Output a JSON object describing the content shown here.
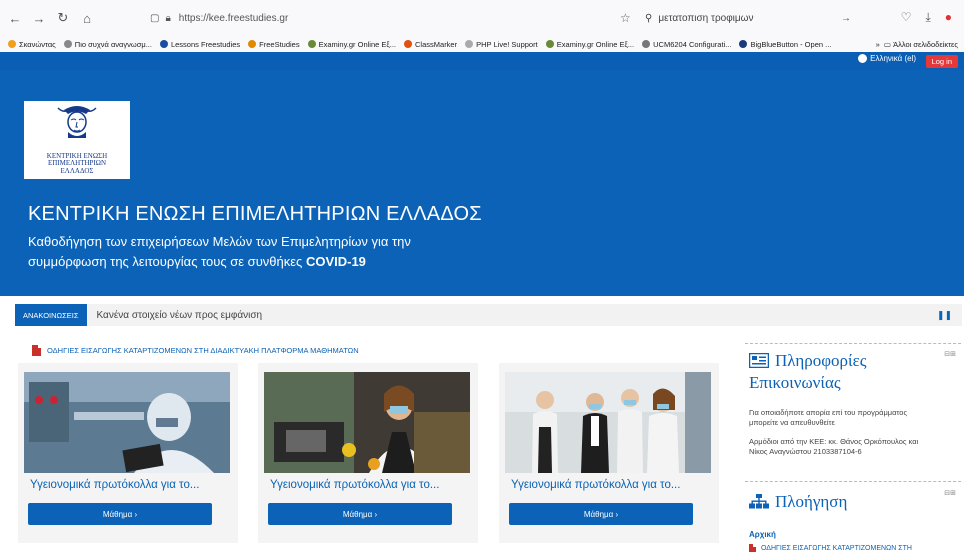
{
  "browser": {
    "url": "https://kee.freestudies.gr",
    "search": "μετατοπιση τροφιμων",
    "bookmarks": [
      "Σκανώντας",
      "Πιο συχνά αναγνωσμ...",
      "Lessons Freestudies",
      "FreeStudies",
      "Examiny.gr Online Εξ...",
      "ClassMarker",
      "PHP Live! Support",
      "Examiny.gr Online Εξ...",
      "UCM6204 Configurati...",
      "BigBlueButton - Open ..."
    ],
    "other_bookmarks": "Άλλοι σελιδοδείκτες"
  },
  "header": {
    "language": "Ελληνικά (el)",
    "login": "Log in"
  },
  "hero": {
    "logo_text": [
      "ΚΕΝΤΡΙΚΗ ΕΝΩΣΗ",
      "ΕΠΙΜΕΛΗΤΗΡΙΩΝ",
      "ΕΛΛΑΔΟΣ"
    ],
    "title": "ΚΕΝΤΡΙΚΗ ΕΝΩΣΗ ΕΠΙΜΕΛΗΤΗΡΙΩΝ ΕΛΛΑΔΟΣ",
    "subtitle_line1": "Καθοδήγηση των επιχειρήσεων Μελών των Επιμελητηρίων για την",
    "subtitle_line2": "συμμόρφωση της λειτουργίας τους σε συνθήκες",
    "subtitle_bold": "COVID-19"
  },
  "news": {
    "tag": "ΑΝΑΚΟΙΝΩΣΕΙΣ",
    "text": "Κανένα στοιχείο νέων προς εμφάνιση"
  },
  "main": {
    "guide_link": "ΟΔΗΓΙΕΣ ΕΙΣΑΓΩΓΗΣ ΚΑΤΑΡΤΙΖΟΜΕΝΩΝ ΣΤΗ ΔΙΑΔΙΚΤΥΑΚΗ ΠΛΑΤΦΟΡΜΑ ΜΑΘΗΜΑΤΩΝ",
    "courses": [
      {
        "title": "Υγειονομικά πρωτόκολλα για το...",
        "button": "Μάθημα ›"
      },
      {
        "title": "Υγειονομικά πρωτόκολλα για το...",
        "button": "Μάθημα ›"
      },
      {
        "title": "Υγειονομικά πρωτόκολλα για το...",
        "button": "Μάθημα ›"
      }
    ]
  },
  "sidebar": {
    "contact": {
      "title_line1": "Πληροφορίες",
      "title_line2": "Επικοινωνίας",
      "text1_line1": "Για οποιαδήποτε απορία επί του προγράμματος",
      "text1_line2": "μπορείτε να απευθυνθείτε",
      "text2_line1": "Αρμόδιοι από την ΚΕΕ: κκ. Θάνος Ορκόπουλος και",
      "text2_line2": "Νίκος Αναγνώστου 2103387104-6"
    },
    "navigation": {
      "title": "Πλοήγηση",
      "home": "Αρχική",
      "doc": "ΟΔΗΓΙΕΣ ΕΙΣΑΓΩΓΗΣ ΚΑΤΑΡΤΙΖΟΜΕΝΩΝ ΣΤΗ"
    }
  }
}
